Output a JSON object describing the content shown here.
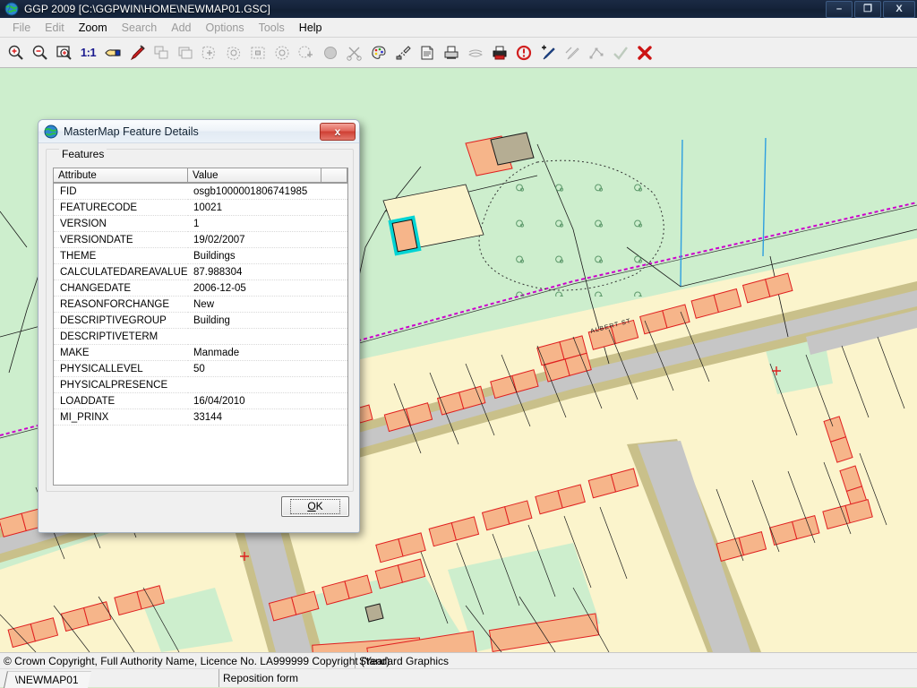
{
  "window": {
    "title": "GGP 2009 [C:\\GGPWIN\\HOME\\NEWMAP01.GSC]",
    "icon": "globe-icon",
    "controls": {
      "minimize": "–",
      "restore": "❐",
      "close": "X"
    }
  },
  "menubar": {
    "items": [
      {
        "label": "File",
        "enabled": false
      },
      {
        "label": "Edit",
        "enabled": false
      },
      {
        "label": "Zoom",
        "enabled": true
      },
      {
        "label": "Search",
        "enabled": false
      },
      {
        "label": "Add",
        "enabled": false
      },
      {
        "label": "Options",
        "enabled": false
      },
      {
        "label": "Tools",
        "enabled": false
      },
      {
        "label": "Help",
        "enabled": true
      }
    ]
  },
  "toolbar": {
    "onetoone_label": "1:1",
    "items": [
      {
        "name": "zoom-in-icon",
        "enabled": true
      },
      {
        "name": "zoom-out-icon",
        "enabled": true
      },
      {
        "name": "zoom-window-icon",
        "enabled": true
      },
      {
        "name": "zoom-one-to-one-icon",
        "enabled": true
      },
      {
        "name": "pan-hand-icon",
        "enabled": true
      },
      {
        "name": "arrow-pointer-icon",
        "enabled": true
      },
      {
        "name": "copy-object-icon",
        "enabled": false
      },
      {
        "name": "layers-icon",
        "enabled": false
      },
      {
        "name": "select-add-icon",
        "enabled": false
      },
      {
        "name": "select-region-icon",
        "enabled": false
      },
      {
        "name": "select-rect-icon",
        "enabled": false
      },
      {
        "name": "select-circle-icon",
        "enabled": false
      },
      {
        "name": "measure-icon",
        "enabled": false
      },
      {
        "name": "fill-icon",
        "enabled": false
      },
      {
        "name": "scissors-icon",
        "enabled": false
      },
      {
        "name": "palette-icon",
        "enabled": true
      },
      {
        "name": "redline-icon",
        "enabled": true
      },
      {
        "name": "document-icon",
        "enabled": true
      },
      {
        "name": "print-preview-icon",
        "enabled": true
      },
      {
        "name": "plot-stack-icon",
        "enabled": false
      },
      {
        "name": "print-icon",
        "enabled": true
      },
      {
        "name": "clock-alert-icon",
        "enabled": true
      },
      {
        "name": "add-pointer-icon",
        "enabled": true
      },
      {
        "name": "remove-pointer-icon",
        "enabled": false
      },
      {
        "name": "node-edit-icon",
        "enabled": false
      },
      {
        "name": "confirm-check-icon",
        "enabled": false
      },
      {
        "name": "cancel-cross-icon",
        "enabled": true
      }
    ]
  },
  "dialog": {
    "title": "MasterMap Feature Details",
    "icon": "globe-icon",
    "close_label": "x",
    "group_label": "Features",
    "columns": [
      "Attribute",
      "Value",
      ""
    ],
    "rows": [
      {
        "attribute": "FID",
        "value": "osgb1000001806741985"
      },
      {
        "attribute": "FEATURECODE",
        "value": "10021"
      },
      {
        "attribute": "VERSION",
        "value": "1"
      },
      {
        "attribute": "VERSIONDATE",
        "value": "19/02/2007"
      },
      {
        "attribute": "THEME",
        "value": "Buildings"
      },
      {
        "attribute": "CALCULATEDAREAVALUE",
        "value": "87.988304"
      },
      {
        "attribute": "CHANGEDATE",
        "value": "2006-12-05"
      },
      {
        "attribute": "REASONFORCHANGE",
        "value": "New"
      },
      {
        "attribute": "DESCRIPTIVEGROUP",
        "value": "Building"
      },
      {
        "attribute": "DESCRIPTIVETERM",
        "value": ""
      },
      {
        "attribute": "MAKE",
        "value": "Manmade"
      },
      {
        "attribute": "PHYSICALLEVEL",
        "value": "50"
      },
      {
        "attribute": "PHYSICALPRESENCE",
        "value": ""
      },
      {
        "attribute": "LOADDATE",
        "value": "16/04/2010"
      },
      {
        "attribute": "MI_PRINX",
        "value": "33144"
      }
    ],
    "ok_button": {
      "mnemonic": "O",
      "rest": "K"
    }
  },
  "statusbar": {
    "copyright": "© Crown Copyright, Full Authority Name, Licence No. LA999999 Copyright (Year)",
    "graphics_mode": "Standard Graphics"
  },
  "tabbar": {
    "tab_label": "\\NEWMAP01",
    "message": "Reposition form"
  },
  "map": {
    "colors": {
      "land_green": "#cdeecd",
      "parcel_cream": "#fbf4cc",
      "building_orange": "#f6b58a",
      "building_outline": "#e02020",
      "road_grey": "#c6c6c6",
      "pavement_olive": "#c9c08a",
      "boundary_magenta": "#cc00cc",
      "water_blue": "#2e9fe0",
      "selection_cyan": "#00d4d4",
      "line_black": "#1a1a1a"
    },
    "street_label": "ALBERT ST",
    "crosshair": "selection-crosshair"
  }
}
